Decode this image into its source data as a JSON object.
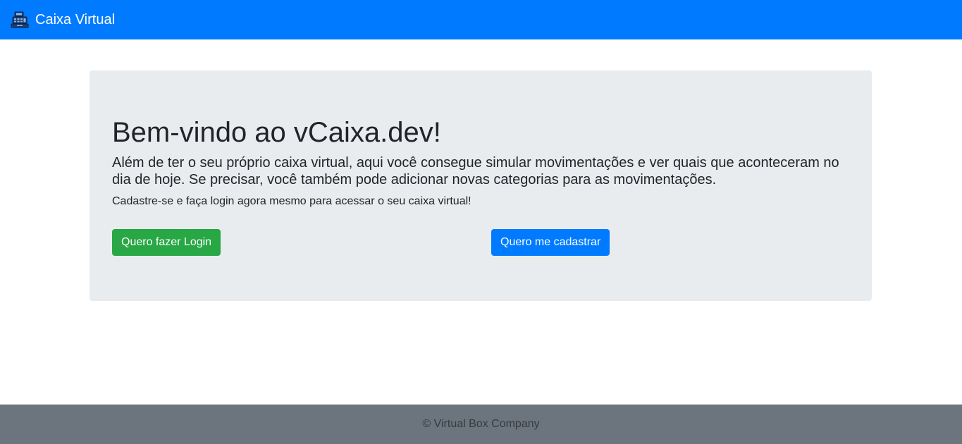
{
  "navbar": {
    "brand_text": "Caixa Virtual",
    "brand_icon": "cash-register-icon",
    "background_color": "#007bff"
  },
  "jumbotron": {
    "title": "Bem-vindo ao vCaixa.dev!",
    "lead": "Além de ter o seu próprio caixa virtual, aqui você consegue simular movimentações e ver quais que aconteceram no dia de hoje. Se precisar, você também pode adicionar novas categorias para as movimentações.",
    "subtext": "Cadastre-se e faça login agora mesmo para acessar o seu caixa virtual!",
    "background_color": "#e9ecef"
  },
  "actions": {
    "login_label": "Quero fazer Login",
    "login_color": "#28a745",
    "register_label": "Quero me cadastrar",
    "register_color": "#007bff"
  },
  "footer": {
    "text": "© Virtual Box Company",
    "background_color": "#6c757d"
  }
}
